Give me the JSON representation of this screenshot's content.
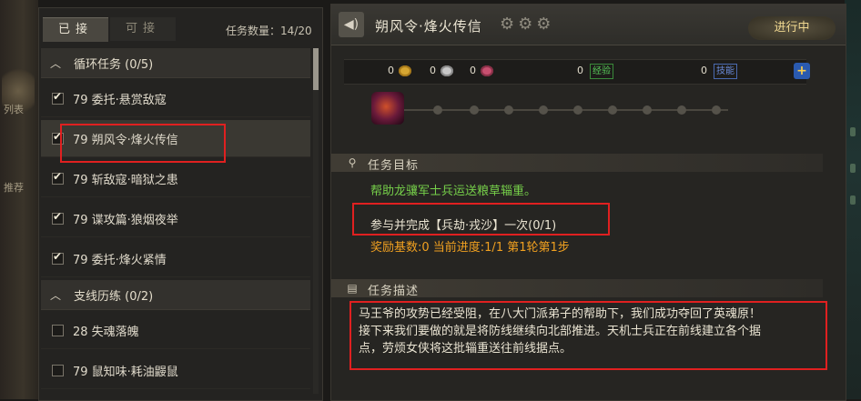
{
  "side_left": {
    "text1": "列表",
    "text2": "推荐"
  },
  "tabs": [
    {
      "label": "已接",
      "active": true
    },
    {
      "label": "可接",
      "active": false
    }
  ],
  "task_count": "任务数量：14/20",
  "groups": [
    {
      "title": "循环任务 (0/5)",
      "items": [
        {
          "label": "79 委托·悬赏敌寇",
          "checked": true,
          "selected": false
        },
        {
          "label": "79 朔风令·烽火传信",
          "checked": true,
          "selected": true
        },
        {
          "label": "79 斩敌寇·暗狱之患",
          "checked": true,
          "selected": false
        },
        {
          "label": "79 谍攻篇·狼烟夜举",
          "checked": true,
          "selected": false
        },
        {
          "label": "79 委托·烽火紧情",
          "checked": true,
          "selected": false
        }
      ]
    },
    {
      "title": "支线历练 (0/2)",
      "items": [
        {
          "label": "28 失魂落魄",
          "checked": false,
          "selected": false
        },
        {
          "label": "79 鼠知味·耗油鼹鼠",
          "checked": false,
          "selected": false
        }
      ]
    }
  ],
  "detail": {
    "title": "朔风令·烽火传信",
    "status": "进行中",
    "rewards": {
      "gold": "0",
      "silver": "0",
      "pink": "0",
      "exp_value": "0",
      "exp_label": "经验",
      "skill_value": "0",
      "skill_label": "技能"
    },
    "goal_header": "任务目标",
    "goal_line1": "帮助龙骧军士兵运送粮草辎重。",
    "goal_line2": "参与并完成【兵劫·戎沙】一次(0/1)",
    "goal_line3": "奖励基数:0  当前进度:1/1 第1轮第1步",
    "desc_header": "任务描述",
    "desc_line1": "马王爷的攻势已经受阻，在八大门派弟子的帮助下，我们成功夺回了英魂原！",
    "desc_line2": "接下来我们要做的就是将防线继续向北部推进。天机士兵正在前线建立各个据",
    "desc_line3": "点，劳烦女侠将这批辎重送往前线据点。"
  },
  "colors": {
    "accent_gold": "#f0d890",
    "goal_green": "#76d04a",
    "goal_orange": "#f0a020",
    "highlight_red": "#e02020"
  }
}
